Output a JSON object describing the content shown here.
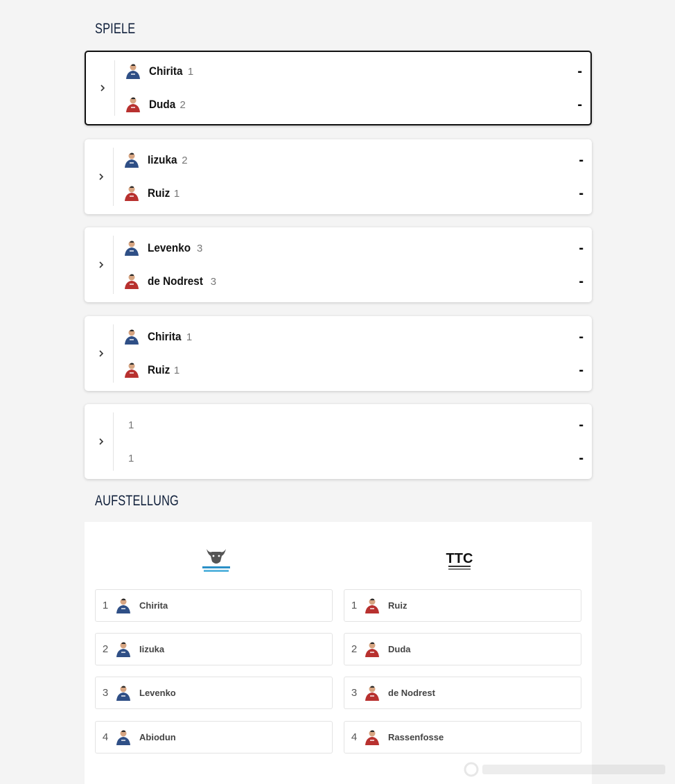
{
  "spiele": {
    "title": "SPIELE",
    "matches": [
      {
        "selected": true,
        "home": {
          "name": "Chirita",
          "num": "1",
          "team": "blue"
        },
        "away": {
          "name": "Duda",
          "num": "2",
          "team": "red"
        },
        "home_score": "-",
        "away_score": "-"
      },
      {
        "selected": false,
        "home": {
          "name": "Iizuka",
          "num": "2",
          "team": "blue"
        },
        "away": {
          "name": "Ruiz",
          "num": "1",
          "team": "red"
        },
        "home_score": "-",
        "away_score": "-"
      },
      {
        "selected": false,
        "home": {
          "name": "Levenko",
          "num": "3",
          "team": "blue"
        },
        "away": {
          "name": "de Nodrest",
          "num": "3",
          "team": "red"
        },
        "home_score": "-",
        "away_score": "-"
      },
      {
        "selected": false,
        "home": {
          "name": "Chirita",
          "num": "1",
          "team": "blue"
        },
        "away": {
          "name": "Ruiz",
          "num": "1",
          "team": "red"
        },
        "home_score": "-",
        "away_score": "-"
      },
      {
        "selected": false,
        "home": {
          "name": "",
          "num": "1",
          "team": "none"
        },
        "away": {
          "name": "",
          "num": "1",
          "team": "none"
        },
        "home_score": "-",
        "away_score": "-"
      }
    ],
    "expand_icon": "chevron-right-icon"
  },
  "aufstellung": {
    "title": "AUFSTELLUNG",
    "home_team": {
      "logo": "bull-logo",
      "logo_text": "TTC NEU-ULM",
      "players": [
        {
          "num": "1",
          "name": "Chirita"
        },
        {
          "num": "2",
          "name": "Iizuka"
        },
        {
          "num": "3",
          "name": "Levenko"
        },
        {
          "num": "4",
          "name": "Abiodun"
        }
      ]
    },
    "away_team": {
      "logo": "ttc-logo",
      "logo_text": "TTC",
      "logo_subtext": "SCHWALBE · BERGNEUSTADT",
      "players": [
        {
          "num": "1",
          "name": "Ruiz"
        },
        {
          "num": "2",
          "name": "Duda"
        },
        {
          "num": "3",
          "name": "de Nodrest"
        },
        {
          "num": "4",
          "name": "Rassenfosse"
        }
      ]
    }
  },
  "colors": {
    "home_jersey": "#2f4f86",
    "away_jersey": "#b8312f",
    "title": "#0f1f3a",
    "background": "#f4f4f4"
  }
}
